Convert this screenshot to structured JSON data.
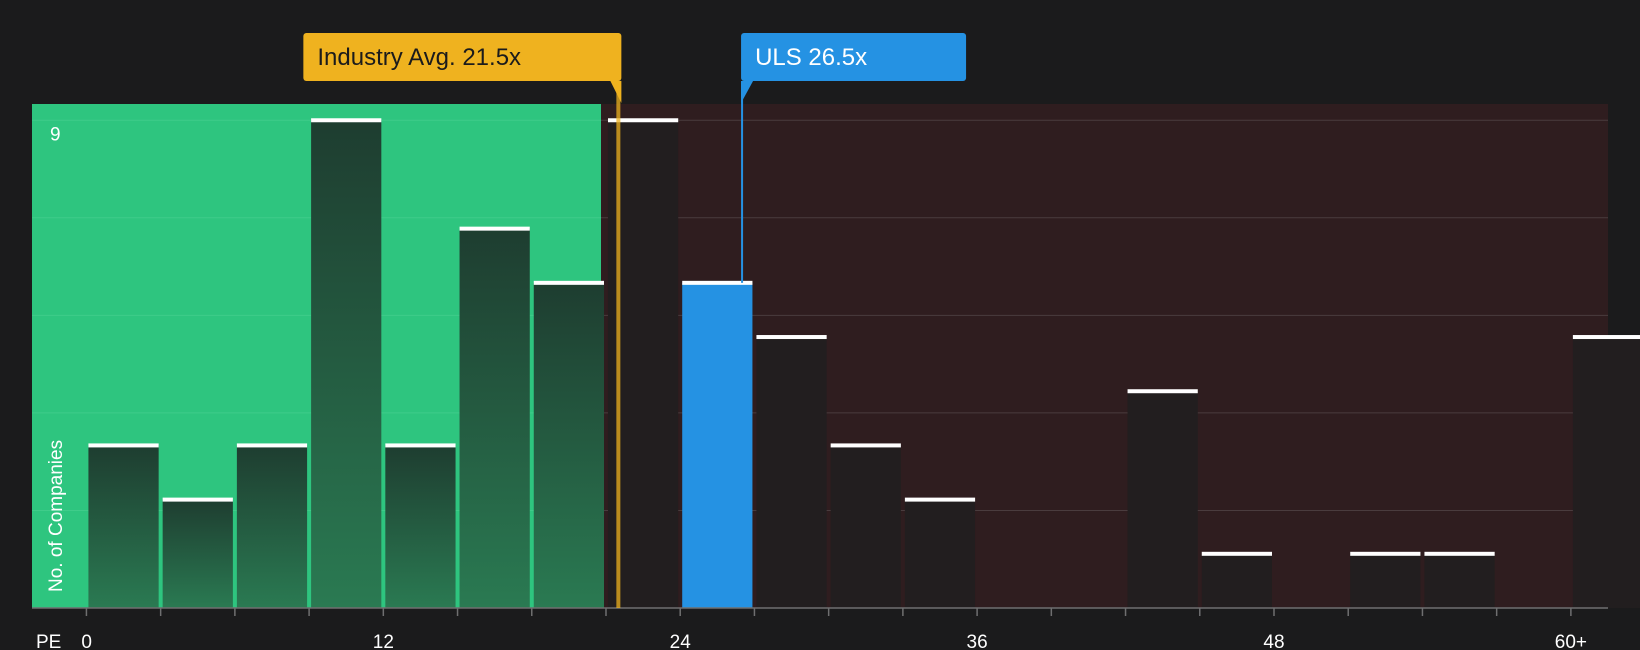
{
  "chart_data": {
    "type": "bar",
    "x_axis_label": "PE",
    "y_axis_label": "No. of Companies",
    "x_ticks": [
      {
        "value": 0,
        "label": "0"
      },
      {
        "value": 12,
        "label": "12"
      },
      {
        "value": 24,
        "label": "24"
      },
      {
        "value": 36,
        "label": "36"
      },
      {
        "value": 48,
        "label": "48"
      },
      {
        "value": 60,
        "label": "60+"
      }
    ],
    "y_ticks": [
      {
        "value": 9,
        "label": "9"
      }
    ],
    "xlim": [
      -2.2,
      61.5
    ],
    "ylim": [
      0,
      9.3
    ],
    "bin_width": 3,
    "bins": [
      {
        "start": 0,
        "count": 3
      },
      {
        "start": 3,
        "count": 2
      },
      {
        "start": 6,
        "count": 3
      },
      {
        "start": 9,
        "count": 9
      },
      {
        "start": 12,
        "count": 3
      },
      {
        "start": 15,
        "count": 7
      },
      {
        "start": 18,
        "count": 6
      },
      {
        "start": 21,
        "count": 9
      },
      {
        "start": 24,
        "count": 6
      },
      {
        "start": 27,
        "count": 5
      },
      {
        "start": 30,
        "count": 3
      },
      {
        "start": 33,
        "count": 2
      },
      {
        "start": 36,
        "count": 0
      },
      {
        "start": 39,
        "count": 0
      },
      {
        "start": 42,
        "count": 4
      },
      {
        "start": 45,
        "count": 1
      },
      {
        "start": 48,
        "count": 0
      },
      {
        "start": 51,
        "count": 1
      },
      {
        "start": 54,
        "count": 1
      },
      {
        "start": 57,
        "count": 0
      },
      {
        "start": 60,
        "count": 5
      }
    ],
    "highlight_bin_start": 24,
    "fair_region_end": 20.8,
    "markers": [
      {
        "name": "industry",
        "label": "Industry Avg. 21.5x",
        "value": 21.5,
        "color": "#efb21f",
        "text_color": "#1b1b1c"
      },
      {
        "name": "company",
        "label": "ULS 26.5x",
        "value": 26.5,
        "color": "#2592e3",
        "text_color": "#ffffff"
      }
    ],
    "grid": true,
    "colors": {
      "background": "#1b1b1c",
      "fair_region": "#2ec57f",
      "expensive_region": "#2f1d1f",
      "bar_in_fair": "#234a39",
      "bar_in_expensive": "#221e1f",
      "highlight_bar": "#2592e3",
      "bar_top": "#ffffff",
      "grid": "#4a3c3e"
    }
  }
}
